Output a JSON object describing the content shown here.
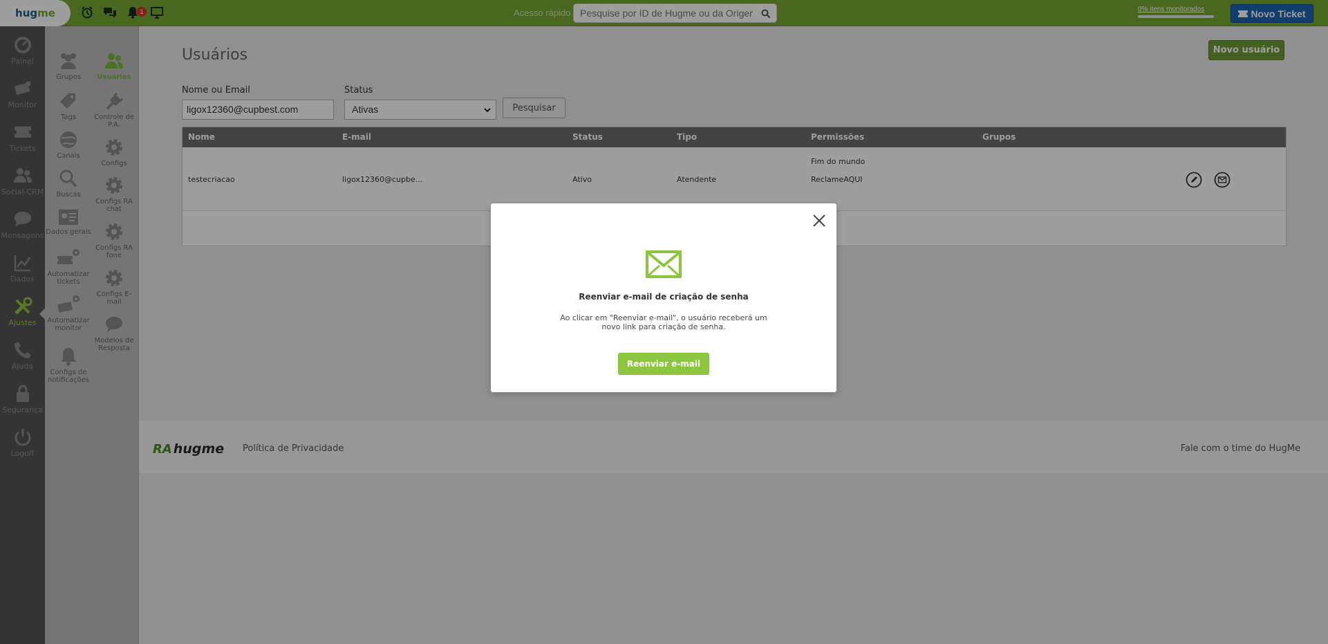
{
  "topbar": {
    "logo_left": "hug",
    "logo_right": "me",
    "notification_count": "1",
    "quick_access_label": "Acesso rápido",
    "search_placeholder": "Pesquise por ID de Hugme ou da Origem",
    "monitored_text": "0% itens monitorados",
    "monitored_progress_percent": 0,
    "new_ticket_label": "Novo Ticket"
  },
  "sidebar": {
    "items": [
      {
        "label": "Painel",
        "icon": "dashboard-icon"
      },
      {
        "label": "Monitor",
        "icon": "camera-icon"
      },
      {
        "label": "Tickets",
        "icon": "ticket-icon"
      },
      {
        "label": "Social-CRM",
        "icon": "people-icon"
      },
      {
        "label": "Mensagens",
        "icon": "chat-icon"
      },
      {
        "label": "Dados",
        "icon": "chart-icon"
      },
      {
        "label": "Ajustes",
        "icon": "tools-icon"
      },
      {
        "label": "Ajuda",
        "icon": "phone-icon"
      },
      {
        "label": "Segurança",
        "icon": "lock-icon"
      },
      {
        "label": "Logoff",
        "icon": "power-icon"
      }
    ],
    "active": "Ajustes"
  },
  "submenu": {
    "left": [
      {
        "label": "Grupos",
        "icon": "group-icon"
      },
      {
        "label": "Tags",
        "icon": "tag-icon"
      },
      {
        "label": "Canais",
        "icon": "globe-icon"
      },
      {
        "label": "Buscas",
        "icon": "search-icon"
      },
      {
        "label": "Dados gerais",
        "icon": "id-card-icon"
      },
      {
        "label": "Automatizar tickets",
        "icon": "automate-tickets-icon"
      },
      {
        "label": "Automatizar monitor",
        "icon": "automate-monitor-icon"
      },
      {
        "label": "Configs de notificações",
        "icon": "bell-icon"
      }
    ],
    "right": [
      {
        "label": "Usuários",
        "icon": "users-icon"
      },
      {
        "label": "Controle de P.A.",
        "icon": "plug-icon"
      },
      {
        "label": "Configs",
        "icon": "gear-icon"
      },
      {
        "label": "Configs RA chat",
        "icon": "gear-icon"
      },
      {
        "label": "Configs RA fone",
        "icon": "gear-icon"
      },
      {
        "label": "Configs E-mail",
        "icon": "gear-icon"
      },
      {
        "label": "Modelos de Resposta",
        "icon": "chat-icon"
      }
    ],
    "active": "Usuários"
  },
  "main": {
    "title": "Usuários",
    "new_user_label": "Novo usuário",
    "filters": {
      "name_label": "Nome ou Email",
      "name_value": "ligox12360@cupbest.com",
      "status_label": "Status",
      "status_value": "Ativas",
      "search_button": "Pesquisar"
    },
    "table": {
      "columns": [
        "Nome",
        "E-mail",
        "Status",
        "Tipo",
        "Permissões",
        "Grupos"
      ],
      "rows": [
        {
          "nome": "testecriacao",
          "email": "ligox12360@cupbe...",
          "status": "Ativo",
          "tipo": "Atendente",
          "permissoes": [
            "Fim do mundo",
            "ReclameAQUI"
          ],
          "grupos": ""
        }
      ]
    }
  },
  "footer": {
    "logo_mark": "RA",
    "logo_text": "hugme",
    "privacy": "Política de Privacidade",
    "contact": "Fale com o time do HugMe"
  },
  "modal": {
    "title": "Reenviar e-mail de criação de senha",
    "body": "Ao clicar em \"Reenviar e-mail\", o usuário receberá um novo link para criação de senha.",
    "button": "Reenviar e-mail"
  },
  "colors": {
    "topbar": "#78a735",
    "accent": "#8cc63f",
    "new_ticket": "#1d64b0",
    "sidebar": "#555555",
    "submenu": "#bdbdbd"
  }
}
